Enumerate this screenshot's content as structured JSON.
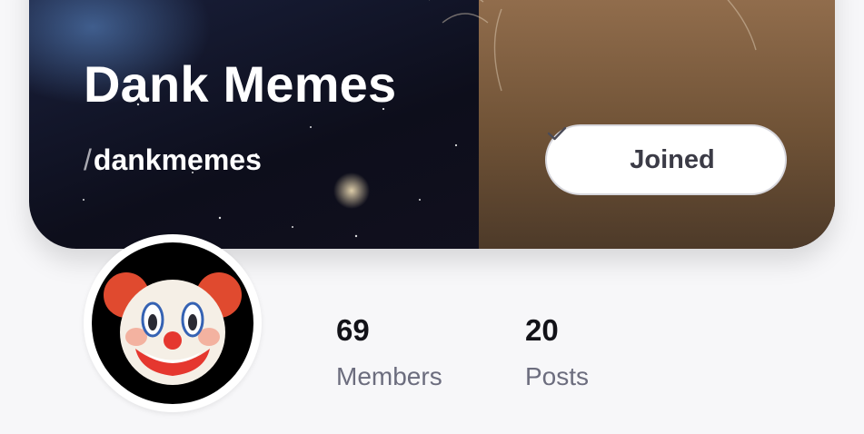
{
  "community": {
    "name": "Dank Memes",
    "handle_prefix": "/",
    "handle": "dankmemes"
  },
  "join_button": {
    "label": "Joined",
    "icon": "check-icon"
  },
  "avatar": {
    "icon": "clown-face-icon"
  },
  "stats": {
    "members": {
      "value": "69",
      "label": "Members"
    },
    "posts": {
      "value": "20",
      "label": "Posts"
    }
  },
  "colors": {
    "page_background": "#f7f7f9",
    "banner_space": "#0e0f1c",
    "banner_cat": "#7a5a3a",
    "button_text": "#3b3b46",
    "stat_label": "#6c6d7e"
  }
}
